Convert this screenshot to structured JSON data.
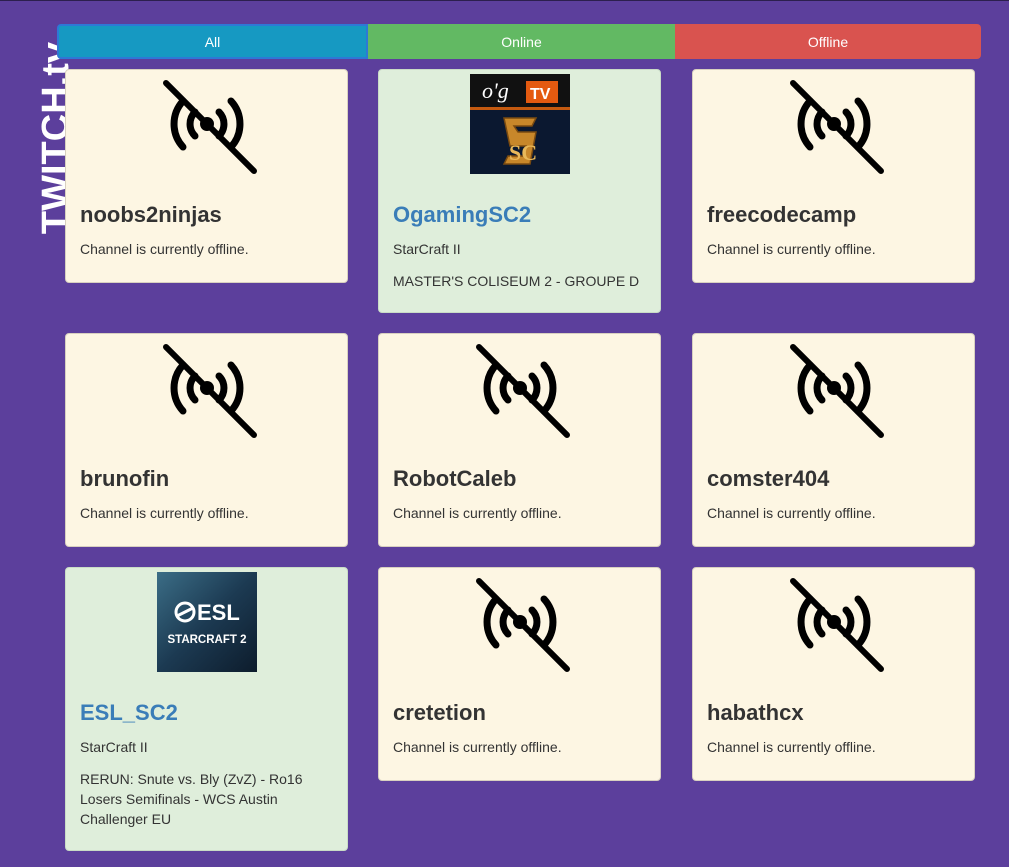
{
  "brand": "TWITCH.tv",
  "filters": {
    "all": "All",
    "online": "Online",
    "offline": "Offline"
  },
  "colors": {
    "background": "#5c3f9c",
    "all": "#1699c2",
    "online": "#62b963",
    "offline": "#d9534f",
    "online_card": "#dfeedb",
    "offline_card": "#fdf6e3",
    "online_name": "#3a7db8"
  },
  "channels": [
    {
      "name": "noobs2ninjas",
      "status": "offline",
      "message": "Channel is currently offline.",
      "icon": "no-signal-icon"
    },
    {
      "name": "OgamingSC2",
      "status": "online",
      "game": "StarCraft II",
      "title": "MASTER'S COLISEUM 2 - GROUPE D",
      "logo_text": [
        "o'g",
        "TV",
        "SC"
      ]
    },
    {
      "name": "freecodecamp",
      "status": "offline",
      "message": "Channel is currently offline.",
      "icon": "no-signal-icon"
    },
    {
      "name": "brunofin",
      "status": "offline",
      "message": "Channel is currently offline.",
      "icon": "no-signal-icon"
    },
    {
      "name": "RobotCaleb",
      "status": "offline",
      "message": "Channel is currently offline.",
      "icon": "no-signal-icon"
    },
    {
      "name": "comster404",
      "status": "offline",
      "message": "Channel is currently offline.",
      "icon": "no-signal-icon"
    },
    {
      "name": "ESL_SC2",
      "status": "online",
      "game": "StarCraft II",
      "title": "RERUN: Snute vs. Bly (ZvZ) - Ro16 Losers Semifinals - WCS Austin Challenger EU",
      "logo_text": [
        "ESL",
        "STARCRAFT 2"
      ]
    },
    {
      "name": "cretetion",
      "status": "offline",
      "message": "Channel is currently offline.",
      "icon": "no-signal-icon"
    },
    {
      "name": "habathcx",
      "status": "offline",
      "message": "Channel is currently offline.",
      "icon": "no-signal-icon"
    }
  ]
}
